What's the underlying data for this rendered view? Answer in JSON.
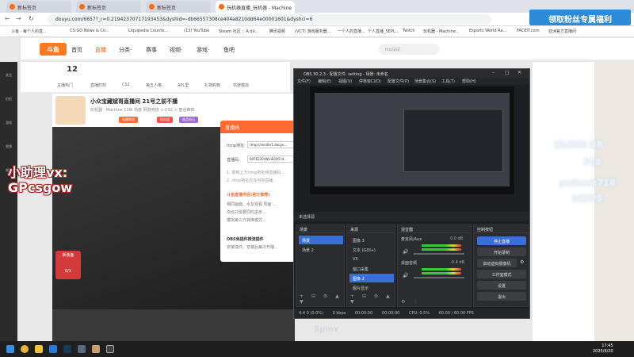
{
  "browser": {
    "tabs": [
      {
        "label": "新标签页"
      },
      {
        "label": "新标签页"
      },
      {
        "label": "新标签页"
      },
      {
        "label": "玩机器直播_玩机器 - Machine"
      }
    ],
    "url": "douyu.com/6657?_r=0.21942370717193453&dyshid=-db66557308ce404a8210dd64e00001601&dyshci=6",
    "bookmarks": [
      "斗鱼 - 每个人的直...",
      "CS:GO News & Co...",
      "Liquipedia Counte...",
      "(13) YouTube",
      "Steam 社区 :: A dir...",
      "腾讯视频",
      "(VCT) 游戏服务器...",
      "一个人的直播...",
      "个人直播_5EPL...",
      "Twitch",
      "玩机器 - Machine...",
      "Esports World Ra...",
      "FACEIT.com",
      "亚洲官方直播间"
    ]
  },
  "promo": {
    "label": "领取粉丝专属福利"
  },
  "douyu": {
    "logo": "斗鱼",
    "nav": [
      "首页",
      "直播",
      "分类·",
      "赛事",
      "视频·",
      "游戏·",
      "鱼吧"
    ],
    "search_placeholder": "hiiz试试",
    "cats": [
      "主播热门",
      "直播时刻",
      "CS2",
      "第五人格",
      "APL里",
      "礼物购物",
      "驾驶模拟"
    ],
    "cat_count": "12",
    "room": {
      "title": "小众宝藏斌哥直播间 21号之前不播",
      "sub": "玩机器 · Machine  12W  热度  网游竞技 > CS2 > 童话推荐",
      "badges": [
        "私播频道",
        "粉丝团",
        "极品钻石"
      ],
      "badge_colors": [
        "#ff6a30",
        "#ff4d4d",
        "#9b6ad8"
      ]
    },
    "rail": [
      "关注",
      "历史",
      "游戏",
      "视频",
      "频道"
    ],
    "gift": {
      "label": "新装备",
      "count": "0/1"
    },
    "helper_text": [
      "小助理vx:",
      "GPcsgow"
    ],
    "overlay": {
      "team": "BLACK BR",
      "num": "718",
      "vx": "pwkaok718",
      "fps": "56FPS"
    },
    "spinx": "Spinx"
  },
  "push_panel": {
    "title": "直播码",
    "rtmp_label": "rtmp地址:",
    "rtmp_value": "rtmp://sendtv1.douyu...",
    "key_label": "直播码:",
    "key_value": "6976220rWIsiEOX5?d...",
    "notes": [
      "1. 复制上方rtmp地址和直播码...",
      "2. rtmp地址仅在当前直播..."
    ],
    "tool_title": "斗鱼直播伴侣(官方推荐)",
    "tool_lines": [
      "相同画面、水友观看'原画'...",
      "你也只需要同时多步...",
      "模拟第三方转换模式..."
    ],
    "plugin": "OBS免插件推流插件",
    "plugin_line": "安装插件、安装后每次开播..."
  },
  "obs": {
    "title": "OBS 30.2.3 - 配置文件: setting - 场景: 未命名",
    "menu": [
      "文件(F)",
      "编辑(E)",
      "视图(V)",
      "停靠窗口(D)",
      "配置文件(P)",
      "场景集合(S)",
      "工具(T)",
      "帮助(H)"
    ],
    "src_bar": "未选择源",
    "scenes_title": "场景",
    "scenes": [
      "场景",
      "场景 2"
    ],
    "sources_title": "来源",
    "sources": [
      "图像 3",
      "文本 (GDI+)",
      "VX",
      "窗口采集",
      "图像 2",
      "图片显示"
    ],
    "mixer_title": "混音器",
    "mixer": [
      {
        "name": "麦克风/Aux",
        "db": "0.0 dB"
      },
      {
        "name": "桌面音频",
        "db": "-0.4 dB"
      }
    ],
    "controls_title": "控制按钮",
    "controls": [
      "停止直播",
      "开始录制",
      "启动虚拟摄像机",
      "工作室模式",
      "设置",
      "退出"
    ],
    "status": [
      "4:4 0 (0.0%)",
      "0 kbps",
      "00:00:00",
      "00:00:00",
      "CPU: 0.5%",
      "60.00 / 60.00 FPS"
    ]
  },
  "taskbar": {
    "time": "17:45",
    "date": "2025/4/20"
  }
}
